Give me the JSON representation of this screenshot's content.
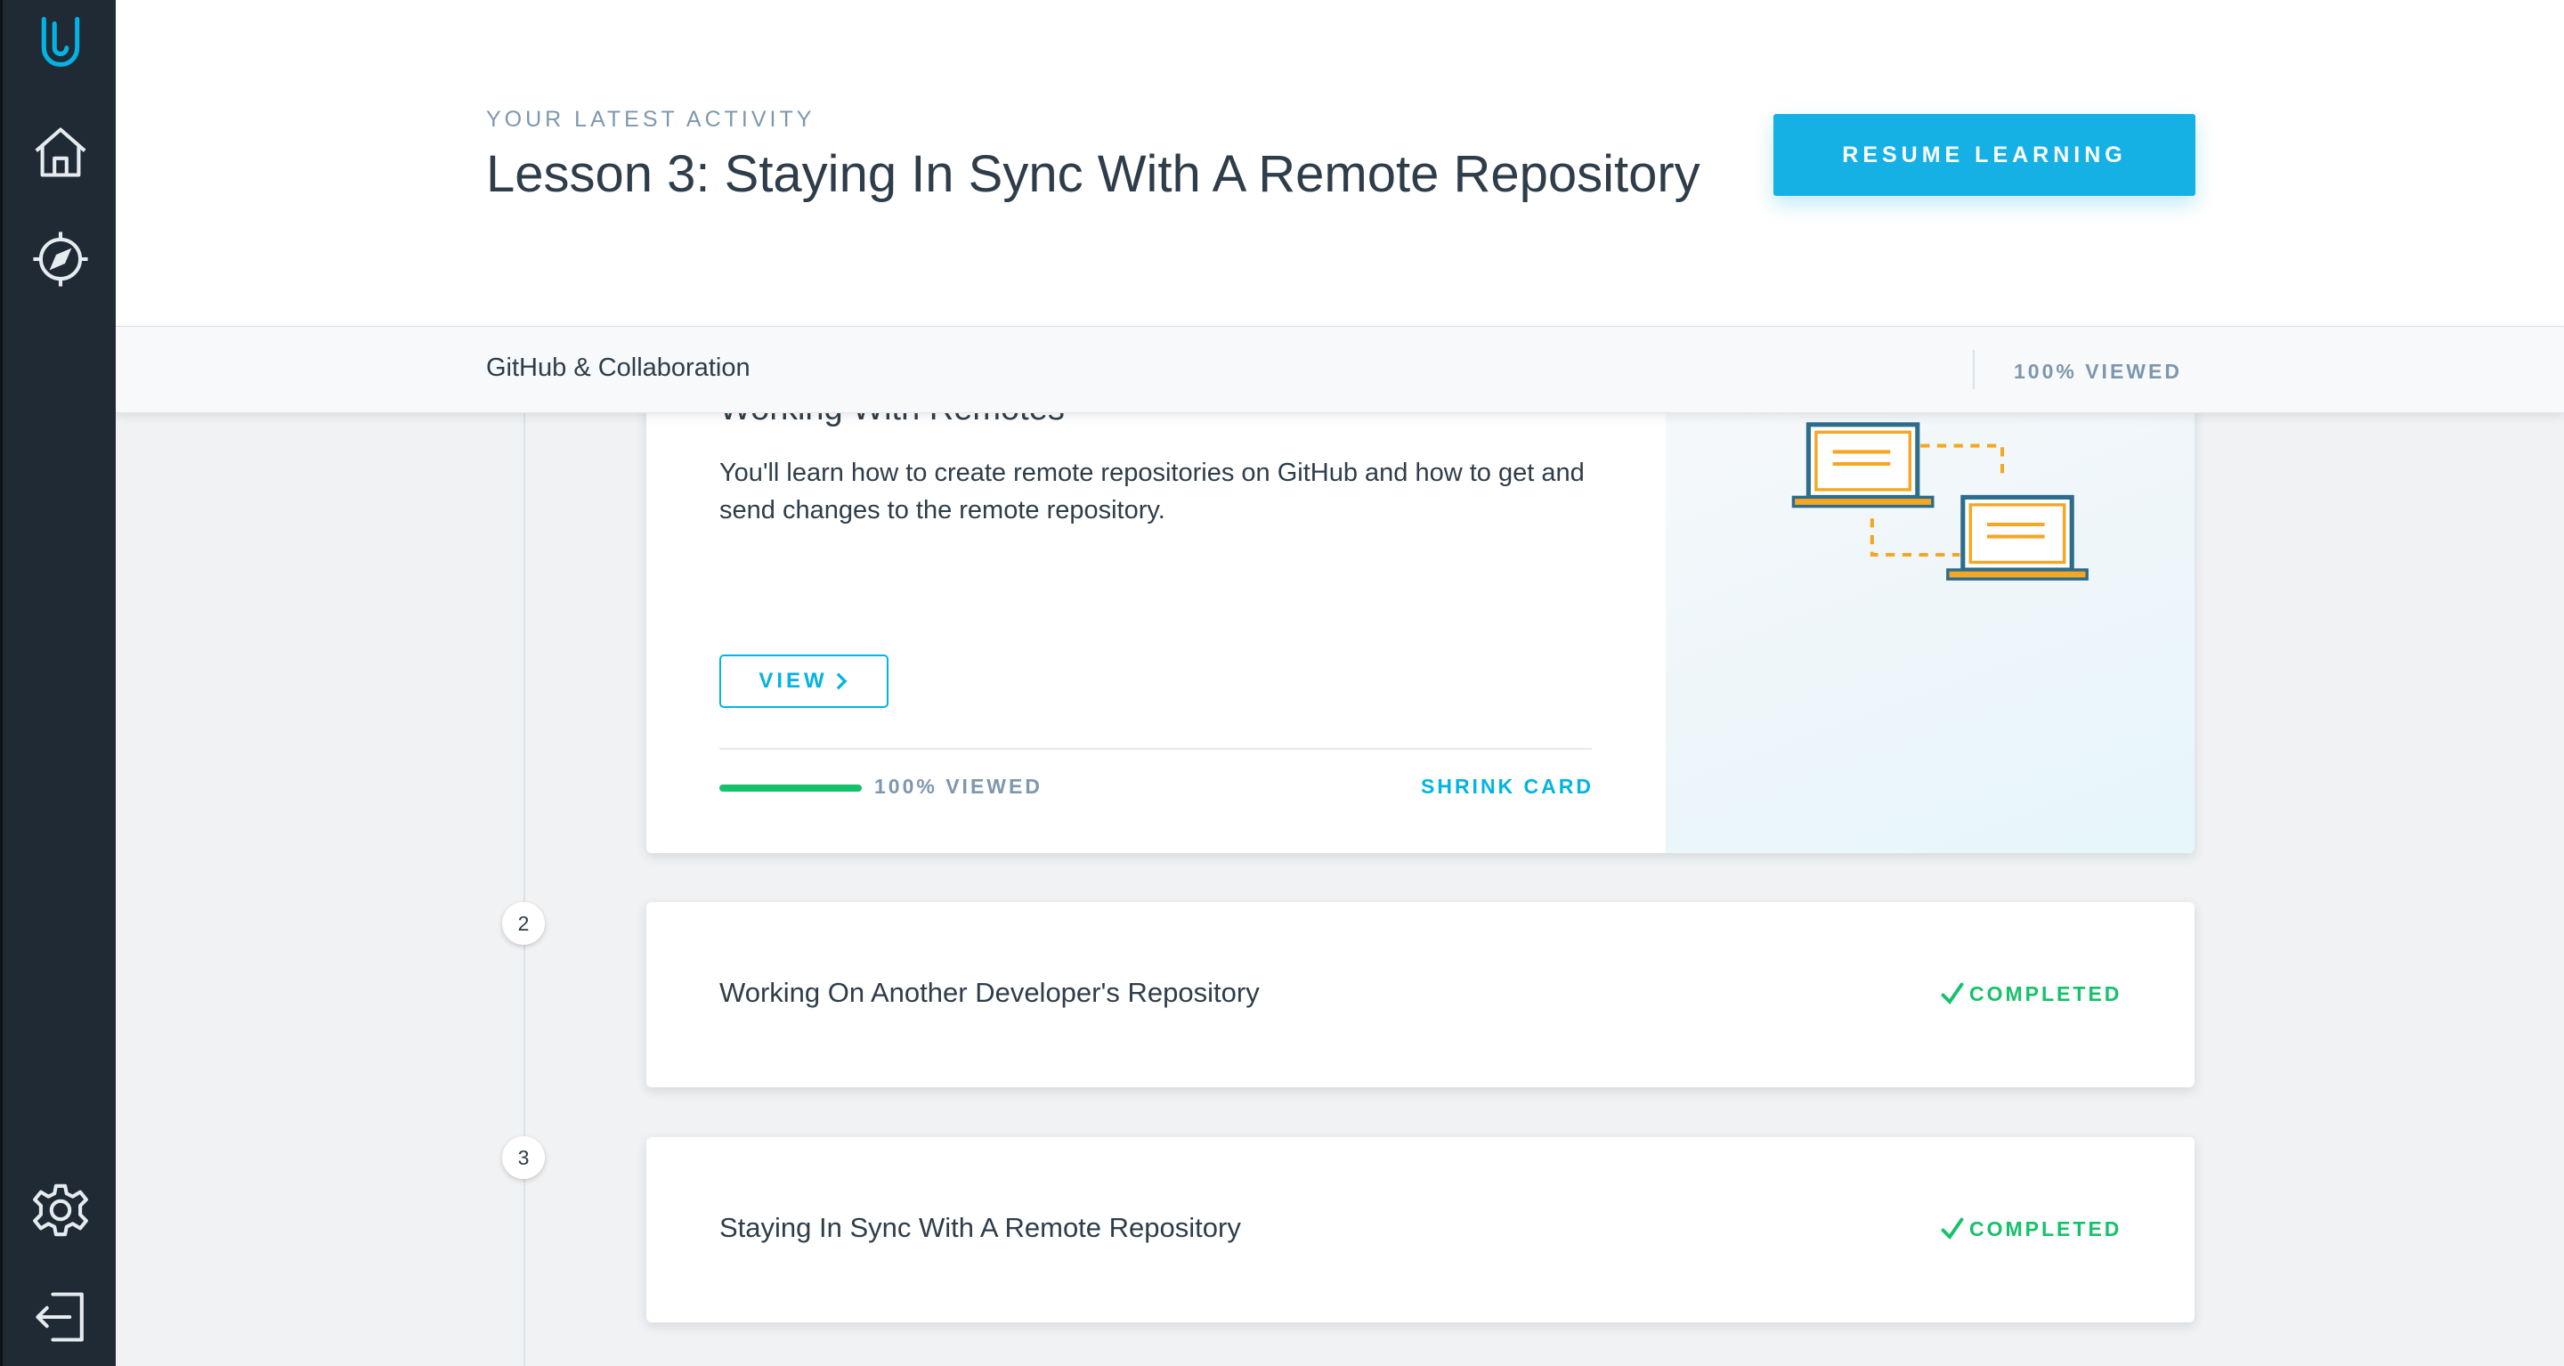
{
  "header": {
    "eyebrow": "YOUR LATEST ACTIVITY",
    "lesson_title": "Lesson 3: Staying In Sync With A Remote Repository",
    "resume_label": "RESUME LEARNING"
  },
  "subbar": {
    "course_name": "GitHub & Collaboration",
    "progress_label": "100% VIEWED"
  },
  "sidebar": {
    "items": [
      {
        "icon": "udacity-logo-icon"
      },
      {
        "icon": "home-icon"
      },
      {
        "icon": "compass-icon"
      },
      {
        "icon": "gear-icon"
      },
      {
        "icon": "logout-icon"
      }
    ]
  },
  "lessons": [
    {
      "title_partial": "Working With Remotes",
      "description": "You'll learn how to create remote repositories on GitHub and how to get and send changes to the remote repository.",
      "view_label": "VIEW",
      "progress": 1.0,
      "progress_label": "100% VIEWED",
      "shrink_label": "SHRINK CARD",
      "illustration": "two-laptops-connected-icon"
    },
    {
      "number": "2",
      "title": "Working On Another Developer's Repository",
      "status": "COMPLETED"
    },
    {
      "number": "3",
      "title": "Staying In Sync With A Remote Repository",
      "status": "COMPLETED"
    }
  ],
  "colors": {
    "accent": "#02b3e4",
    "success": "#15c26b",
    "sidebar": "#1f2a34",
    "illustration_frame": "#2c6c8c",
    "illustration_accent": "#f5a623"
  }
}
